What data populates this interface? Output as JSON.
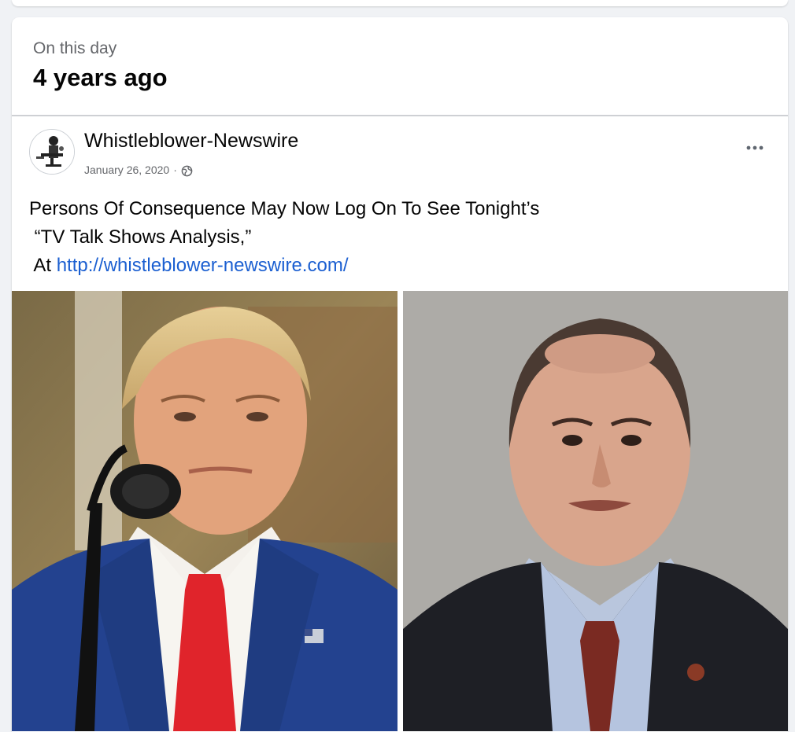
{
  "memory": {
    "subtitle": "On this day",
    "title": "4 years ago"
  },
  "post": {
    "page_name": "Whistleblower-Newswire",
    "date": "January 26, 2020",
    "separator": "·",
    "audience_icon": "globe-icon",
    "more_icon": "more-options-icon",
    "text_lines": [
      "Persons Of Consequence May Now Log On To See Tonight’s",
      " “TV Talk Shows Analysis,”",
      " At "
    ],
    "link": "http://whistleblower-newswire.com/"
  },
  "colors": {
    "link": "#1b5fd1",
    "secondary_text": "#65676b",
    "background": "#f0f2f5"
  }
}
